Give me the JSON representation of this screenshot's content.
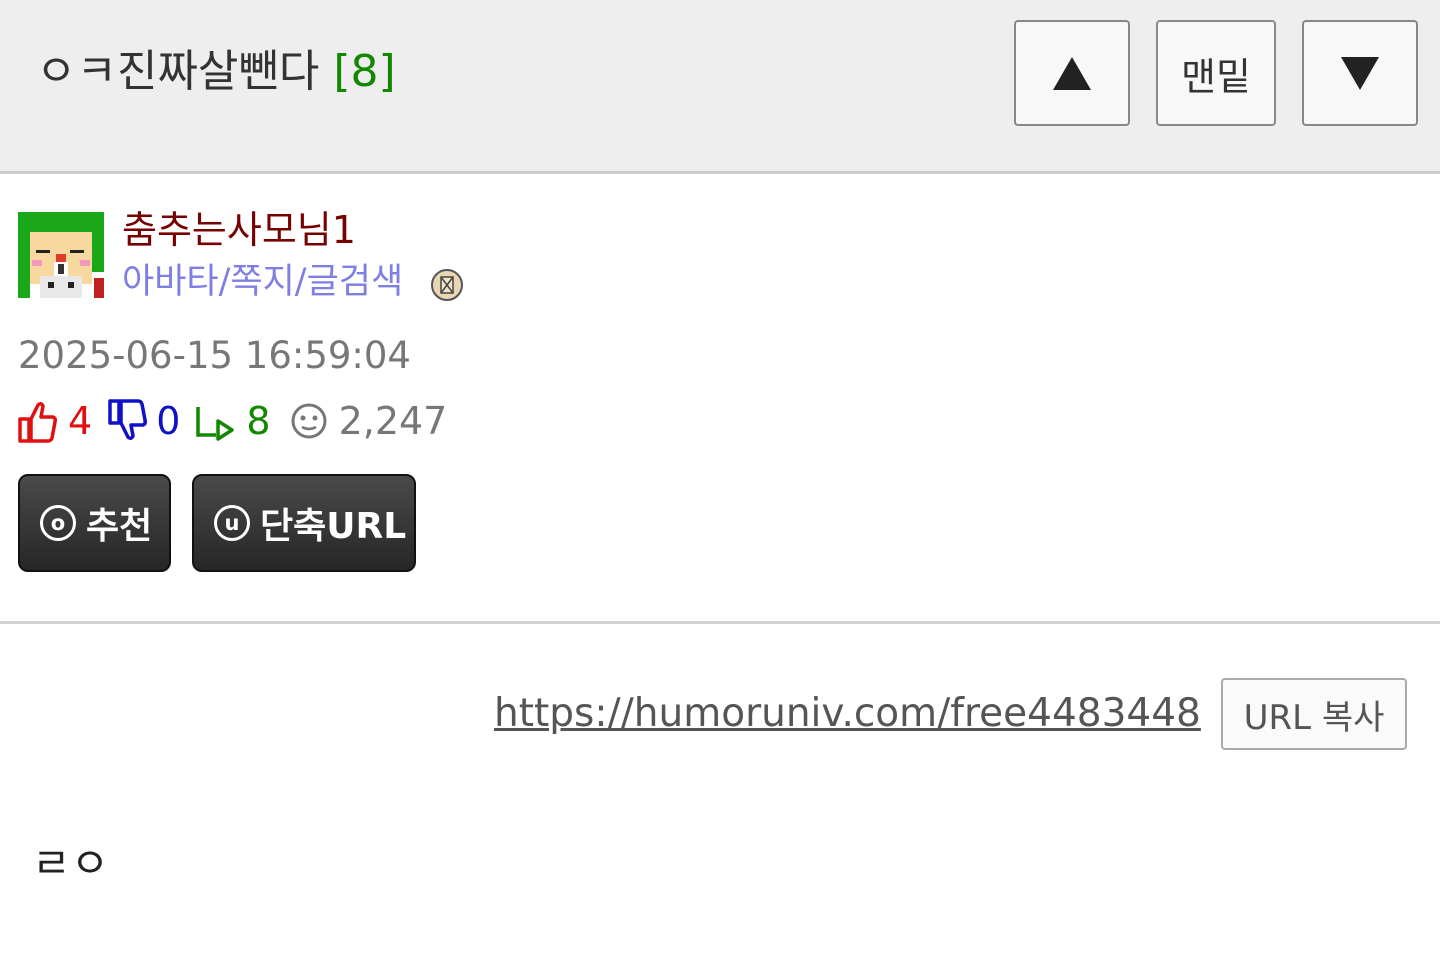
{
  "header": {
    "title": "ㅇㅋ진짜살뺀다",
    "comment_count": "[8]",
    "buttons": {
      "up_icon": "triangle-up-icon",
      "bottom_label": "맨밑",
      "down_icon": "triangle-down-icon"
    }
  },
  "author": {
    "name": "춤추는사모님1",
    "links": "아바타/쪽지/글검색",
    "avatar_icon": "pixel-avatar-icon",
    "badge_icon": "level-badge-icon"
  },
  "post": {
    "date": "2025-06-15 16:59:04",
    "stats": {
      "likes": "4",
      "dislikes": "0",
      "replies": "8",
      "views": "2,247"
    },
    "actions": {
      "recommend_label": "추천",
      "recommend_icon_letter": "o",
      "shorturl_label": "단축URL",
      "shorturl_icon_letter": "u"
    },
    "url": "https://humoruniv.com/free4483448",
    "copy_label": "URL 복사",
    "body": "ㄹㅇ"
  },
  "colors": {
    "header_bg": "#eeeeee",
    "comment_count": "#118800",
    "author_name": "#770000",
    "author_links": "#7f7fe3",
    "like": "#e01010",
    "dislike": "#1010c8",
    "reply": "#118800",
    "meta": "#777777"
  }
}
